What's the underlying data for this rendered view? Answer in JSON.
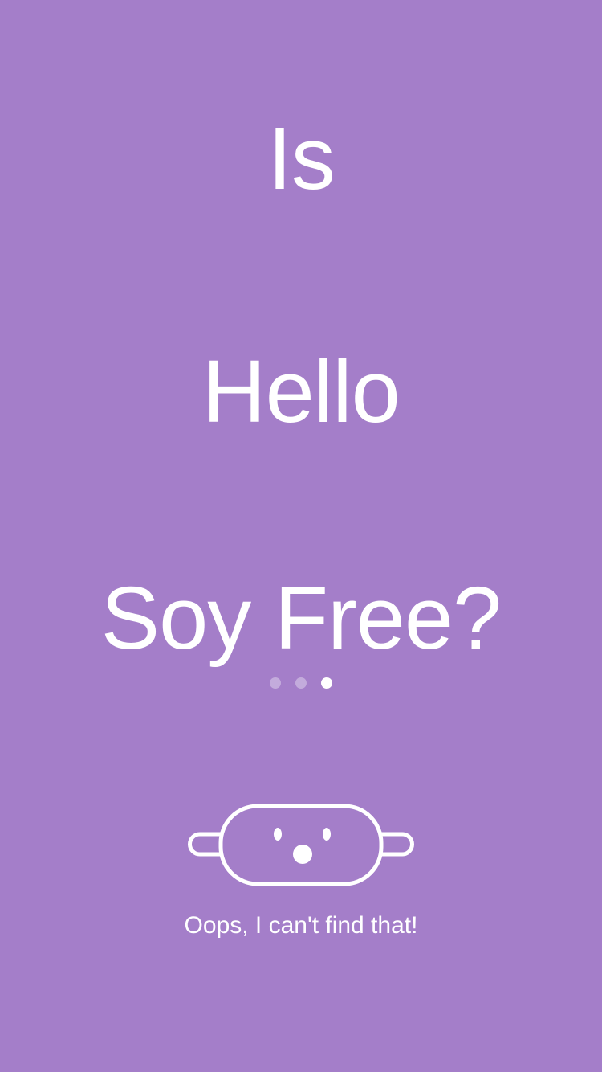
{
  "headline": {
    "line1": "Is",
    "line2": "Hello",
    "line3": "Soy Free?"
  },
  "pagination": {
    "pages": 3,
    "active_index": 2
  },
  "result": {
    "icon": "rolling-pin-face-icon",
    "message": "Oops, I can't find that!"
  },
  "colors": {
    "background": "#a47ec9",
    "foreground": "#ffffff"
  }
}
